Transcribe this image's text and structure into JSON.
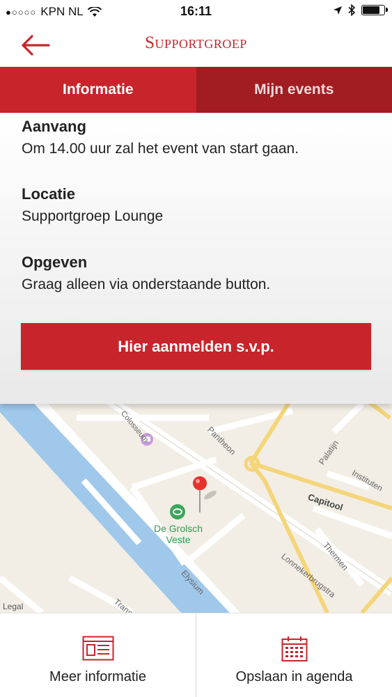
{
  "status_bar": {
    "carrier": "KPN NL",
    "time": "16:11",
    "battery_level_pct": 80
  },
  "header": {
    "title": "Supportgroep",
    "back_icon": "arrow-left-icon",
    "accent_color": "#c8242b"
  },
  "tabs": [
    {
      "label": "Informatie",
      "active": true
    },
    {
      "label": "Mijn events",
      "active": false
    }
  ],
  "info": {
    "sections": [
      {
        "heading": "Aanvang",
        "text": "Om 14.00 uur zal het event van start gaan."
      },
      {
        "heading": "Locatie",
        "text": "Supportgroep Lounge"
      },
      {
        "heading": "Opgeven",
        "text": "Graag alleen via onderstaande button."
      }
    ],
    "cta_label": "Hier aanmelden s.v.p."
  },
  "map": {
    "poi_label_1": "De Grolsch",
    "poi_label_2": "Veste",
    "streets": {
      "colosseum": "Colosseum",
      "pantheon": "Pantheon",
      "palatijn": "Palatijn",
      "instituten": "Instituten",
      "capitool": "Capitool",
      "thermen": "Thermen",
      "elysium": "Elysium",
      "lonnekerbrugstraat": "Lonnekerbrugstra",
      "trans": "Trans"
    },
    "legal": "Legal"
  },
  "bottom_bar": [
    {
      "label": "Meer informatie",
      "icon": "info-page-icon"
    },
    {
      "label": "Opslaan in agenda",
      "icon": "calendar-icon"
    }
  ]
}
